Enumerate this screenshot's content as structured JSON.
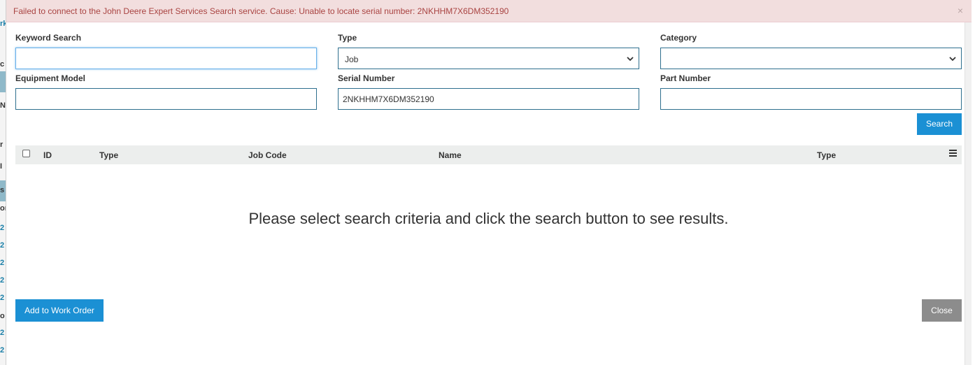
{
  "alert": {
    "message": "Failed to connect to the John Deere Expert Services Search service. Cause: Unable to locate serial number: 2NKHHM7X6DM352190",
    "close_glyph": "×"
  },
  "form": {
    "keyword": {
      "label": "Keyword Search",
      "value": "",
      "placeholder": ""
    },
    "type": {
      "label": "Type",
      "selected": "Job"
    },
    "category": {
      "label": "Category",
      "selected": ""
    },
    "equipment_model": {
      "label": "Equipment Model",
      "value": ""
    },
    "serial_number": {
      "label": "Serial Number",
      "value": "2NKHHM7X6DM352190"
    },
    "part_number": {
      "label": "Part Number",
      "value": ""
    },
    "search_label": "Search"
  },
  "table": {
    "columns": [
      "ID",
      "Type",
      "Job Code",
      "Name",
      "Type"
    ],
    "empty_message": "Please select search criteria and click the search button to see results."
  },
  "footer": {
    "add_label": "Add to Work Order",
    "close_label": "Close"
  },
  "colors": {
    "primary": "#1b90d4",
    "alert_bg": "#f2dede",
    "alert_text": "#a94442",
    "grey_button": "#8c8c8c"
  },
  "background_fragments": [
    "rk",
    "c",
    "N",
    "r",
    "I",
    "s",
    "or",
    "2",
    "2",
    "2",
    "2",
    "2",
    "o",
    "2",
    "2"
  ]
}
